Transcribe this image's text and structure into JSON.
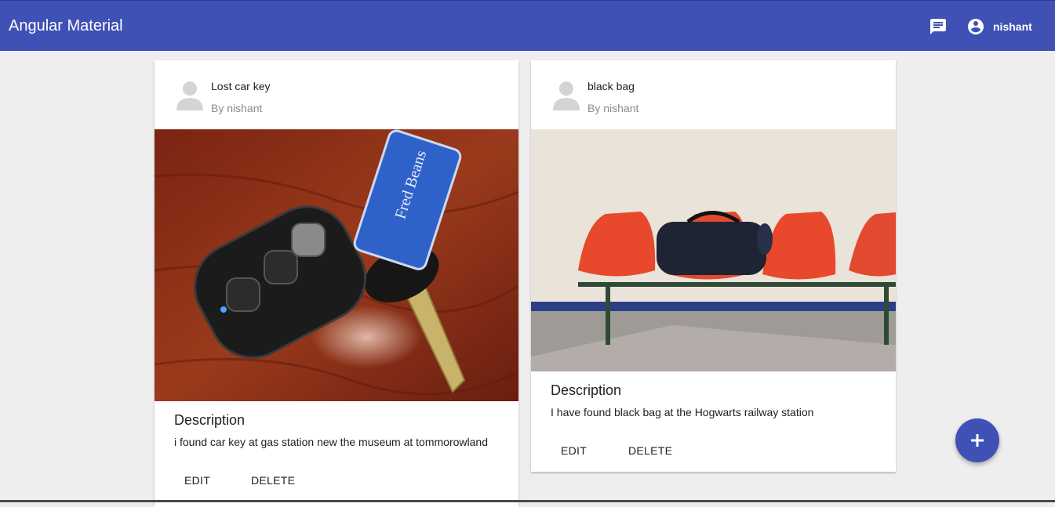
{
  "toolbar": {
    "title": "Angular Material",
    "chat_icon": "chat-icon",
    "account_icon": "account-circle-icon",
    "username": "nishant",
    "color": "#3f51b5"
  },
  "cards": [
    {
      "title": "Lost car key",
      "subtitle": "By nishant",
      "image": "photo of car key fob with keychain tag on wooden table",
      "description_title": "Description",
      "description": "i found car key at gas station new the museum at tommorowland",
      "actions": [
        "EDIT",
        "DELETE"
      ]
    },
    {
      "title": "black bag",
      "subtitle": "By nishant",
      "image": "photo of black duffel bag on orange waiting-room chairs",
      "description_title": "Description",
      "description": "I have found black bag at the Hogwarts railway station",
      "actions": [
        "EDIT",
        "DELETE"
      ]
    }
  ],
  "fab": {
    "icon": "plus-icon"
  }
}
